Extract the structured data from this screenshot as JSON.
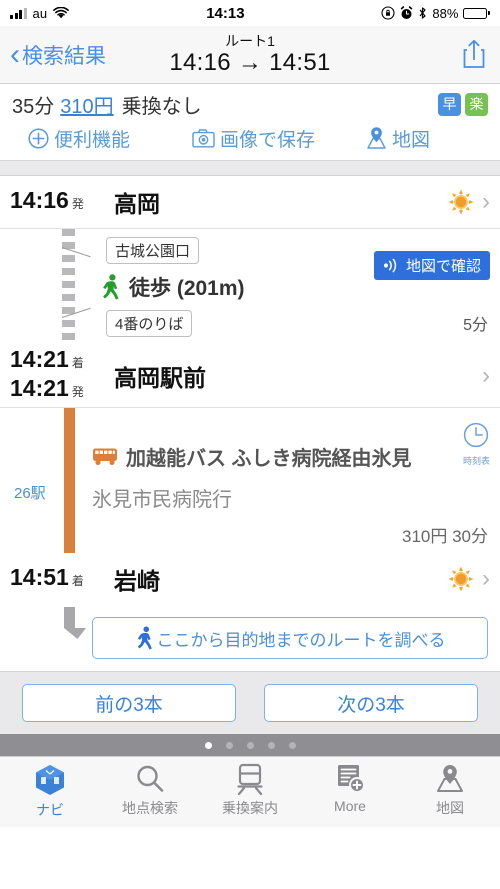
{
  "status_bar": {
    "carrier": "au",
    "time": "14:13",
    "battery_pct": "88%",
    "icons": [
      "signal-bars-icon",
      "wifi-icon",
      "rotation-lock-icon",
      "alarm-icon",
      "bluetooth-icon",
      "battery-icon"
    ]
  },
  "nav": {
    "back_label": "検索結果",
    "route_label": "ルート1",
    "time_range": "14:16 → 14:51",
    "share_icon": "share-icon"
  },
  "summary": {
    "duration": "35分",
    "fare": "310円",
    "transfer": "乗換なし",
    "badge_fast": "早",
    "badge_easy": "楽",
    "tools": [
      {
        "label": "便利機能",
        "icon": "plus-circle-icon"
      },
      {
        "label": "画像で保存",
        "icon": "camera-icon"
      },
      {
        "label": "地図",
        "icon": "map-pin-icon"
      }
    ]
  },
  "route": {
    "departure": {
      "time": "14:16",
      "suffix": "発",
      "station": "高岡",
      "weather_icon": "sun-icon"
    },
    "walk_segment": {
      "exit_label": "古城公園口",
      "platform_label": "4番のりば",
      "mode": "徒歩 (201m)",
      "walk_icon": "walking-person-icon",
      "map_button": "地図で確認",
      "map_button_icon": "signal-waves-icon",
      "duration": "5分"
    },
    "middle": {
      "arrive_time": "14:21",
      "arrive_suffix": "着",
      "depart_time": "14:21",
      "depart_suffix": "発",
      "station": "高岡駅前"
    },
    "bus_segment": {
      "bus_icon": "bus-icon",
      "line_name": "加越能バス ふしき病院経由氷見",
      "destination": "氷見市民病院行",
      "stops": "26駅",
      "timetable_icon": "clock-icon",
      "timetable_label": "時刻表",
      "fare_and_time": "310円 30分"
    },
    "arrival": {
      "time": "14:51",
      "suffix": "着",
      "station": "岩崎",
      "weather_icon": "sun-icon"
    },
    "dest_button": {
      "label": "ここから目的地までのルートを調べる",
      "icon": "walking-person-icon"
    }
  },
  "pager": {
    "prev": "前の3本",
    "next": "次の3本",
    "dots_total": 5,
    "dots_active": 1
  },
  "tabbar": [
    {
      "label": "ナビ",
      "icon": "navigation-cube-icon",
      "active": true
    },
    {
      "label": "地点検索",
      "icon": "search-icon",
      "active": false
    },
    {
      "label": "乗換案内",
      "icon": "train-icon",
      "active": false
    },
    {
      "label": "More",
      "icon": "more-list-icon",
      "active": false
    },
    {
      "label": "地図",
      "icon": "map-pin-icon",
      "active": false
    }
  ],
  "colors": {
    "accent_blue": "#3b82d6",
    "bus_orange": "#d9803c",
    "badge_green": "#77c152"
  }
}
